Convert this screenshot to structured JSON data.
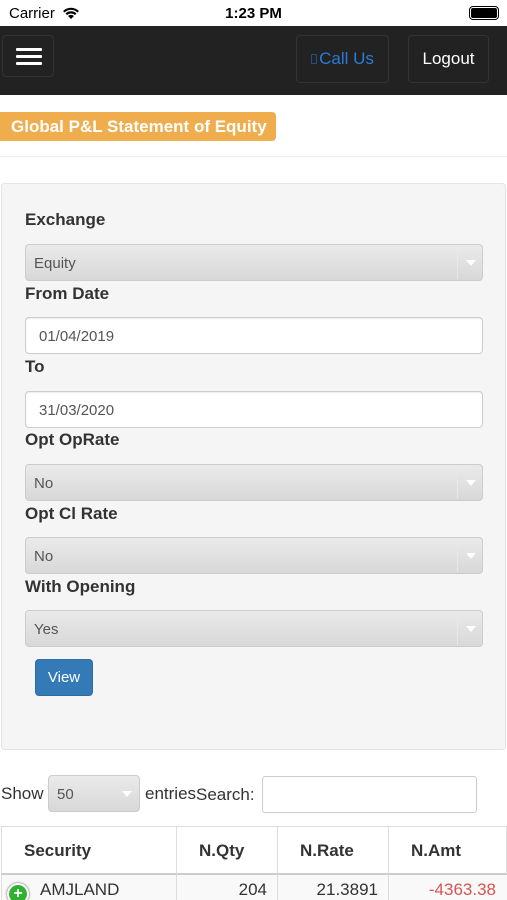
{
  "status_bar": {
    "carrier": "Carrier",
    "time": "1:23 PM"
  },
  "nav": {
    "call_label": "Call Us",
    "logout_label": "Logout"
  },
  "page_title": "Global P&L Statement of Equity",
  "form": {
    "exchange_label": "Exchange",
    "exchange_value": "Equity",
    "from_date_label": "From Date",
    "from_date_value": "01/04/2019",
    "to_label": "To",
    "to_value": "31/03/2020",
    "opt_oprate_label": "Opt OpRate",
    "opt_oprate_value": "No",
    "opt_clrate_label": "Opt Cl Rate",
    "opt_clrate_value": "No",
    "with_opening_label": "With Opening",
    "with_opening_value": "Yes",
    "view_label": "View"
  },
  "table_controls": {
    "show_label": "Show",
    "page_length": "50",
    "entries_label": "entries",
    "search_label": "Search:",
    "search_value": ""
  },
  "table": {
    "columns": [
      "Security",
      "N.Qty",
      "N.Rate",
      "N.Amt"
    ],
    "rows": [
      {
        "security": "AMJLAND",
        "nqty": "204",
        "nrate": "21.3891",
        "namt": "-4363.38"
      }
    ]
  },
  "colors": {
    "navbar": "#222222",
    "title_badge": "#f0ad4e",
    "primary_button": "#337ab7",
    "link": "#2a7bd6",
    "negative": "#d9534f"
  }
}
